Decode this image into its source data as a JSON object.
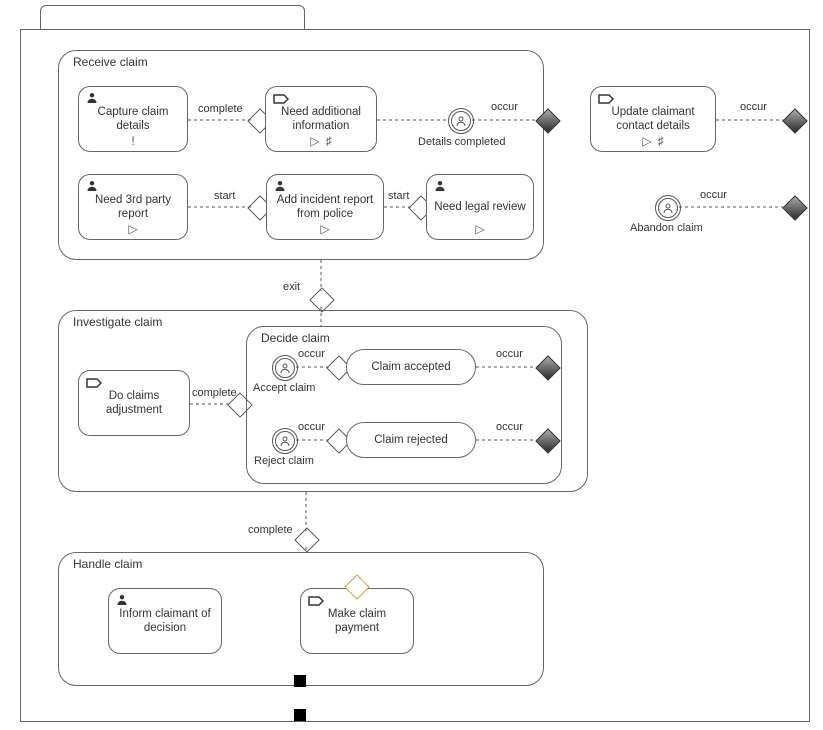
{
  "lanes": {
    "receive": {
      "label": "Receive claim"
    },
    "investigate": {
      "label": "Investigate claim"
    },
    "decide": {
      "label": "Decide claim"
    },
    "handle": {
      "label": "Handle claim"
    }
  },
  "tasks": {
    "capture": {
      "label": "Capture claim details"
    },
    "need_info": {
      "label": "Need additional information"
    },
    "details_done": {
      "label": "Details completed"
    },
    "need_3rd": {
      "label": "Need 3rd party report"
    },
    "add_incident": {
      "label": "Add incident report from police"
    },
    "need_legal": {
      "label": "Need legal review"
    },
    "update_contact": {
      "label": "Update claimant contact details"
    },
    "abandon": {
      "label": "Abandon claim"
    },
    "do_adjust": {
      "label": "Do claims adjustment"
    },
    "accept_ev": {
      "label": "Accept claim"
    },
    "reject_ev": {
      "label": "Reject claim"
    },
    "claim_accepted": {
      "label": "Claim accepted"
    },
    "claim_rejected": {
      "label": "Claim rejected"
    },
    "inform": {
      "label": "Inform claimant of decision"
    },
    "make_payment": {
      "label": "Make claim payment"
    }
  },
  "edges": {
    "complete1": "complete",
    "occur1": "occur",
    "start1": "start",
    "start2": "start",
    "exit": "exit",
    "complete2": "complete",
    "occur_a": "occur",
    "occur_b": "occur",
    "occur_c": "occur",
    "occur_d": "occur",
    "complete3": "complete",
    "occur_ab": "occur",
    "occur_upd": "occur"
  }
}
